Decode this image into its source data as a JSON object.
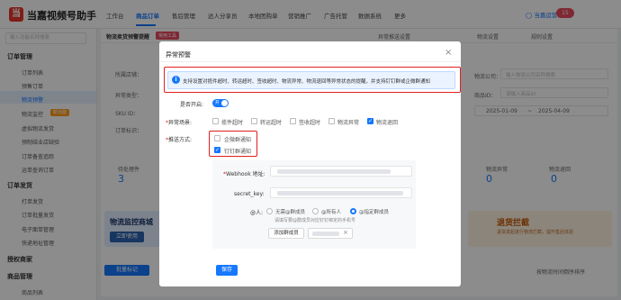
{
  "app": {
    "brand": "当嘉视频号助手",
    "logo_glyph": "当"
  },
  "topnav": {
    "items": [
      {
        "label": "工作台"
      },
      {
        "label": "商品订单"
      },
      {
        "label": "售后管理"
      },
      {
        "label": "达人分享员"
      },
      {
        "label": "本地团购单"
      },
      {
        "label": "营销推广"
      },
      {
        "label": "广告托管"
      },
      {
        "label": "数据系统"
      },
      {
        "label": "更多"
      }
    ],
    "user_label": "◯ 当嘉运营",
    "user_badge": "15"
  },
  "sidebar": {
    "search_placeholder": "输入功能名称搜索",
    "groups": [
      {
        "label": "订单管理",
        "items": [
          "订单列表",
          "预售订单",
          "物流预警",
          "物流监控",
          "虚拟物流发货",
          "预制结业店缺验",
          "订单备查追踪",
          "运单查询订单"
        ]
      },
      {
        "label": "订单发货",
        "items": [
          "打单发货",
          "订单批量发货",
          "电子面单管理",
          "快递地址管理"
        ]
      },
      {
        "label": "授权商家",
        "items": []
      },
      {
        "label": "商品管理",
        "items": [
          "商品列表"
        ]
      }
    ],
    "active_item": "物流预警",
    "new_badge": "新功能"
  },
  "background": {
    "tab_label": "物流卖货预警提醒",
    "tab_tag": "常用工具",
    "field_labels": [
      "所属店铺：",
      "异常类型：",
      "SKU ID：",
      "订单标识："
    ],
    "right_labels": [
      "物流公司：",
      "商品ID："
    ],
    "right_placeholders": [
      "输入物流公司名称搜索",
      "请输入商品ID"
    ],
    "date_start": "2025-01-09",
    "date_sep": "~",
    "date_end": "2025-04-09",
    "stats": [
      {
        "label": "待处理件",
        "value": "3"
      },
      {
        "label": "物流异常",
        "value": "0"
      },
      {
        "label": "物流退回",
        "value": "0"
      }
    ],
    "toolbar_buttons": [
      "物流预警",
      "异常推送设置",
      "物流设置",
      "规则设置"
    ],
    "banner_left": {
      "title": "物流监控商城",
      "button": "立即使用"
    },
    "banner_right": {
      "title": "退货拦截",
      "desc": "退货发起进行物流拦截，提升售后体验"
    },
    "bottom_button": "批量标记",
    "bottom_right_text": "按物流时间倒序排序"
  },
  "modal": {
    "title": "异常预警",
    "close": "×",
    "notice": "支持设置对揽件超时、转运超时、签收超时、物流异常、物流退回等异常状态的提醒，并支持钉钉群或企微群通知",
    "enable_label": "是否开启:",
    "enable_on": "开",
    "scene_label": "异常场景:",
    "scenes": [
      {
        "label": "揽件超时",
        "checked": false
      },
      {
        "label": "转运超时",
        "checked": false
      },
      {
        "label": "签收超时",
        "checked": false
      },
      {
        "label": "物流异常",
        "checked": false
      },
      {
        "label": "物流退回",
        "checked": true
      }
    ],
    "method_label": "推送方式:",
    "methods": [
      {
        "label": "企微群通知",
        "checked": false
      },
      {
        "label": "钉钉群通知",
        "checked": true
      }
    ],
    "webhook_label": "Webhook 地址:",
    "secret_label": "secret_key:",
    "at_label": "@人:",
    "at_options": [
      {
        "label": "无需@群成员",
        "selected": false
      },
      {
        "label": "@所有人",
        "selected": false
      },
      {
        "label": "@指定群成员",
        "selected": true
      }
    ],
    "hint": "请填写要@群成员对应钉钉绑定的手机号",
    "add_button": "添加群成员",
    "tag_close": "×",
    "save_button": "保存"
  }
}
